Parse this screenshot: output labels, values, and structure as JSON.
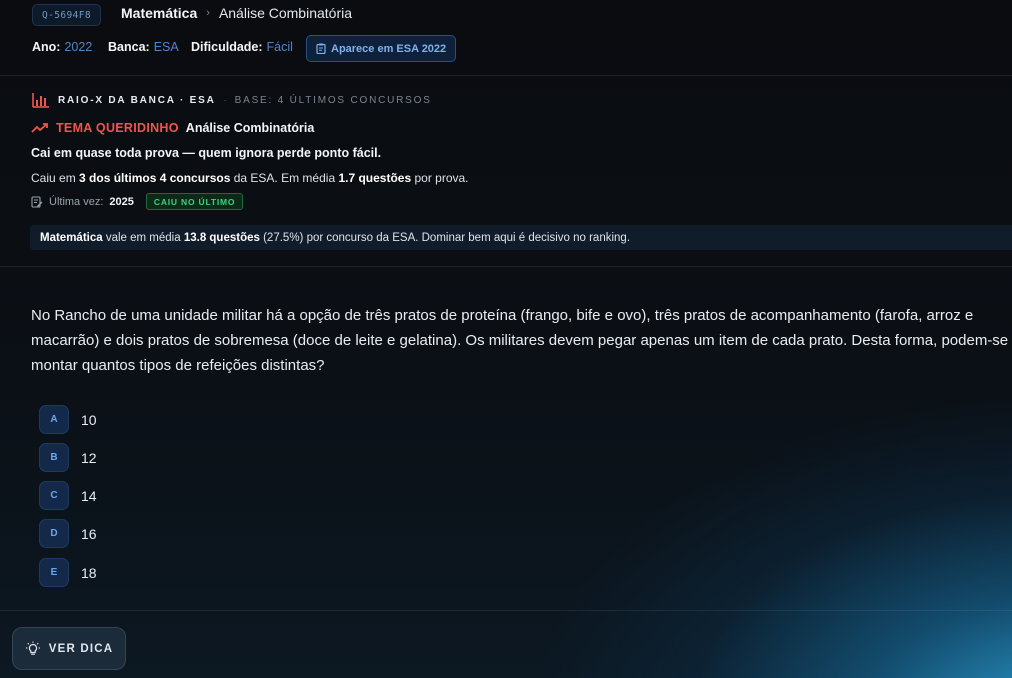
{
  "header": {
    "question_code": "Q-5694F8",
    "breadcrumb": {
      "subject": "Matemática",
      "separator": "›",
      "topic": "Análise Combinatória"
    },
    "meta": {
      "year_label": "Ano:",
      "year_value": "2022",
      "bank_label": "Banca:",
      "bank_value": "ESA",
      "difficulty_label": "Dificuldade:",
      "difficulty_value": "Fácil"
    },
    "appears_button": "Aparece em ESA 2022"
  },
  "raio_x": {
    "title": "RAIO-X DA BANCA · ESA",
    "separator": "·",
    "base": "BASE: 4 ÚLTIMOS CONCURSOS",
    "favorite_label": "TEMA QUERIDINHO",
    "favorite_topic": "Análise Combinatória",
    "headline": "Cai em quase toda prova — quem ignora perde ponto fácil.",
    "stats_line": {
      "p1": "Caiu em ",
      "b1": "3 dos últimos 4 concursos",
      "p2": " da ESA. Em média ",
      "b2": "1.7 questões",
      "p3": " por prova."
    },
    "last_time_label": "Última vez:",
    "last_time_year": "2025",
    "last_badge": "CAIU NO ÚLTIMO",
    "subject_stat": {
      "b1": "Matemática",
      "p1": " vale em média ",
      "b2": "13.8 questões",
      "p2": " (27.5%) por concurso da ESA. Dominar bem aqui é decisivo no ranking."
    }
  },
  "question": {
    "text": "No Rancho de uma unidade militar há a opção de três pratos de proteína (frango, bife e ovo), três pratos de acompanhamento (farofa, arroz e macarrão) e dois pratos de sobremesa (doce de leite e gelatina). Os militares devem pegar apenas um item de cada prato. Desta forma, podem-se montar quantos tipos de refeições distintas?"
  },
  "options": [
    {
      "letter": "A",
      "value": "10"
    },
    {
      "letter": "B",
      "value": "12"
    },
    {
      "letter": "C",
      "value": "14"
    },
    {
      "letter": "D",
      "value": "16"
    },
    {
      "letter": "E",
      "value": "18"
    }
  ],
  "hint_button": "VER DICA",
  "icons": {
    "appears": "clipboard-icon",
    "raio_x": "bar-chart-icon",
    "favorite": "trending-up-icon",
    "last_time": "edit-note-icon",
    "hint": "lightbulb-icon"
  },
  "colors": {
    "accent_blue": "#4f86c8",
    "favorite_red": "#f2534e",
    "success_green": "#3fd07a",
    "option_badge": "#14294a"
  }
}
